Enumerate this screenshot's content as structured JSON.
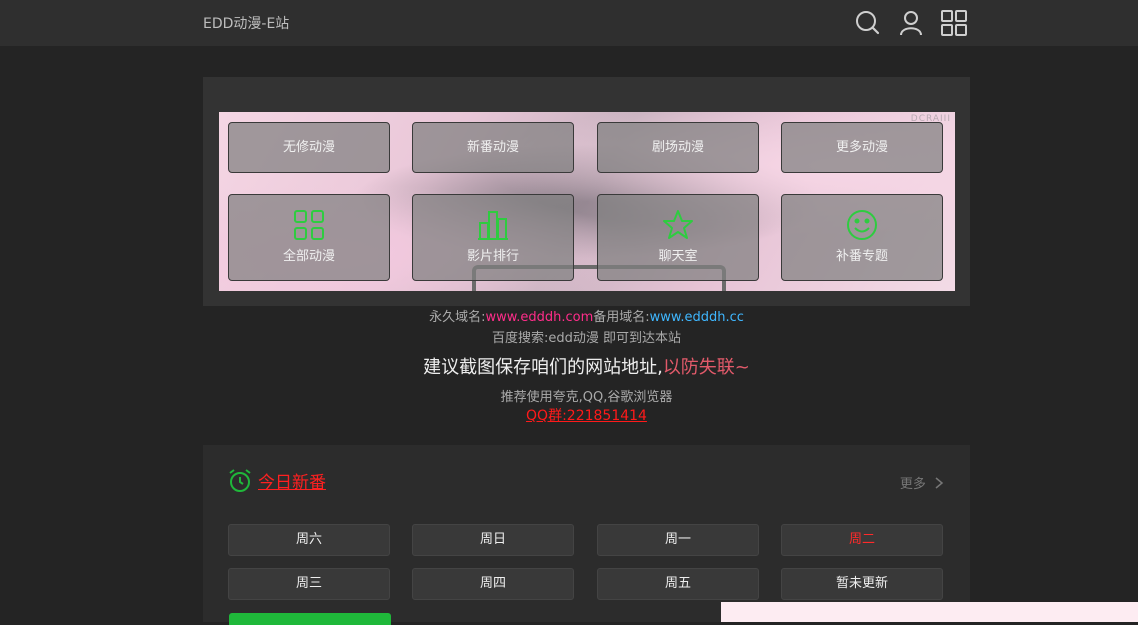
{
  "header": {
    "title": "EDD动漫-E站",
    "icons": [
      "search-icon",
      "user-icon",
      "grid-menu-icon"
    ]
  },
  "banner": {
    "watermark": "DCRAIII",
    "tiles_small": [
      "无修动漫",
      "新番动漫",
      "剧场动漫",
      "更多动漫"
    ],
    "tiles_big": [
      {
        "label": "全部动漫",
        "icon": "grid-icon"
      },
      {
        "label": "影片排行",
        "icon": "ranking-icon"
      },
      {
        "label": "聊天室",
        "icon": "star-icon"
      },
      {
        "label": "补番专题",
        "icon": "smile-icon"
      }
    ]
  },
  "info": {
    "domain_label": "永久域名:",
    "domain": "www.edddh.com",
    "backup_label": "备用域名:",
    "backup_domain": "www.edddh.cc",
    "search_hint": "百度搜索:edd动漫 即可到达本站",
    "save_hint": "建议截图保存咱们的网站地址,",
    "save_hint_red": "以防失联~",
    "browser_hint": "推荐使用夸克,QQ,谷歌浏览器",
    "qq_group": "QQ群:221851414"
  },
  "today": {
    "title": "今日新番",
    "more": "更多",
    "days": [
      "周六",
      "周日",
      "周一",
      "周二",
      "周三",
      "周四",
      "周五",
      "暂未更新"
    ],
    "active_day": "周二"
  },
  "colors": {
    "accent_green": "#1fb83a",
    "accent_red": "#ff2020",
    "domain_pink": "#ff2d8a",
    "domain_blue": "#3fb7ff"
  }
}
